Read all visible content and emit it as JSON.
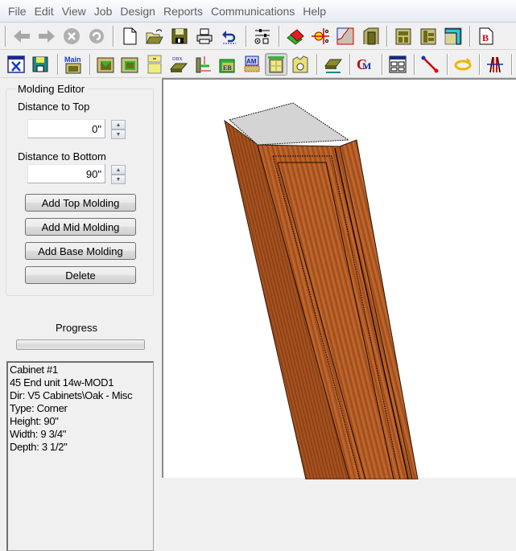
{
  "menu": [
    "File",
    "Edit",
    "View",
    "Job",
    "Design",
    "Reports",
    "Communications",
    "Help"
  ],
  "toolbar1": [
    {
      "icon": "back-arrow-icon",
      "label": "Back",
      "enabled": false
    },
    {
      "icon": "forward-arrow-icon",
      "label": "Forward",
      "enabled": false
    },
    {
      "icon": "stop-icon",
      "label": "Stop",
      "enabled": false
    },
    {
      "icon": "refresh-icon",
      "label": "Refresh",
      "enabled": false
    },
    {
      "separator": true
    },
    {
      "icon": "new-document-icon",
      "label": "New"
    },
    {
      "icon": "open-folder-icon",
      "label": "Open"
    },
    {
      "icon": "save-disk-icon",
      "label": "Save"
    },
    {
      "icon": "printer-icon",
      "label": "Print"
    },
    {
      "icon": "undo-icon",
      "label": "Undo"
    },
    {
      "separator": true
    },
    {
      "icon": "settings-sliders-icon",
      "label": "Options"
    },
    {
      "separator": true
    },
    {
      "icon": "materials-icon",
      "label": "Materials"
    },
    {
      "icon": "lighting-icon",
      "label": "Lighting"
    },
    {
      "icon": "molding-profile-icon",
      "label": "Molding Profiles"
    },
    {
      "icon": "door-frame-icon",
      "label": "Doors"
    },
    {
      "separator": true
    },
    {
      "icon": "cabinet-front-icon",
      "label": "Cabinet"
    },
    {
      "icon": "cabinet-drawers-icon",
      "label": "Drawers"
    },
    {
      "icon": "floor-plan-icon",
      "label": "Floor Plan"
    },
    {
      "separator": true
    },
    {
      "icon": "report-b-icon",
      "label": "B"
    }
  ],
  "toolbar2": [
    {
      "icon": "close-window-icon",
      "label": "Close"
    },
    {
      "icon": "save-green-icon",
      "label": "Save"
    },
    {
      "separator": true
    },
    {
      "icon": "main-icon",
      "label": "Main",
      "text": "Main"
    },
    {
      "separator": true
    },
    {
      "icon": "cabinet-box-icon",
      "label": "Box"
    },
    {
      "icon": "cabinet-interior-icon",
      "label": "Interior"
    },
    {
      "icon": "door-yellow-icon",
      "label": "Door"
    },
    {
      "icon": "drawer-box-icon",
      "label": "Drawer Box",
      "text": "DBX"
    },
    {
      "icon": "dimension-icon",
      "label": "Dimensions"
    },
    {
      "icon": "edge-band-icon",
      "label": "Edge Band",
      "text": "EB"
    },
    {
      "icon": "assembly-icon",
      "label": "Assembly",
      "text": "AM"
    },
    {
      "icon": "molding-editor-icon",
      "label": "Molding Editor",
      "active": true
    },
    {
      "icon": "hardware-icon",
      "label": "Hardware"
    },
    {
      "separator": true
    },
    {
      "icon": "countertop-icon",
      "label": "Countertop"
    },
    {
      "separator": true
    },
    {
      "icon": "cm-icon",
      "label": "CM"
    },
    {
      "separator": true
    },
    {
      "icon": "construction-icon",
      "label": "Construction"
    },
    {
      "separator": true
    },
    {
      "icon": "line-tool-icon",
      "label": "Line"
    },
    {
      "separator": true
    },
    {
      "icon": "rotate-icon",
      "label": "Rotate"
    },
    {
      "separator": true
    },
    {
      "icon": "elevation-icon",
      "label": "Elevation"
    }
  ],
  "molding_editor": {
    "title": "Molding Editor",
    "distance_top_label": "Distance to Top",
    "distance_top_value": "0\"",
    "distance_bottom_label": "Distance to Bottom",
    "distance_bottom_value": "90\"",
    "buttons": [
      "Add Top Molding",
      "Add Mid Molding",
      "Add Base Molding",
      "Delete"
    ]
  },
  "progress": {
    "label": "Progress",
    "value": 0
  },
  "cabinet_info": [
    "Cabinet #1",
    "45 End unit 14w-MOD1",
    "Dir: V5 Cabinets\\Oak - Misc",
    "Type: Corner",
    "Height: 90\"",
    "Width: 9 3/4\"",
    "Depth: 3 1/2\""
  ],
  "colors": {
    "wood": "#b5612a",
    "wood_dark": "#8a4318",
    "top_face": "#d4d4d4"
  }
}
